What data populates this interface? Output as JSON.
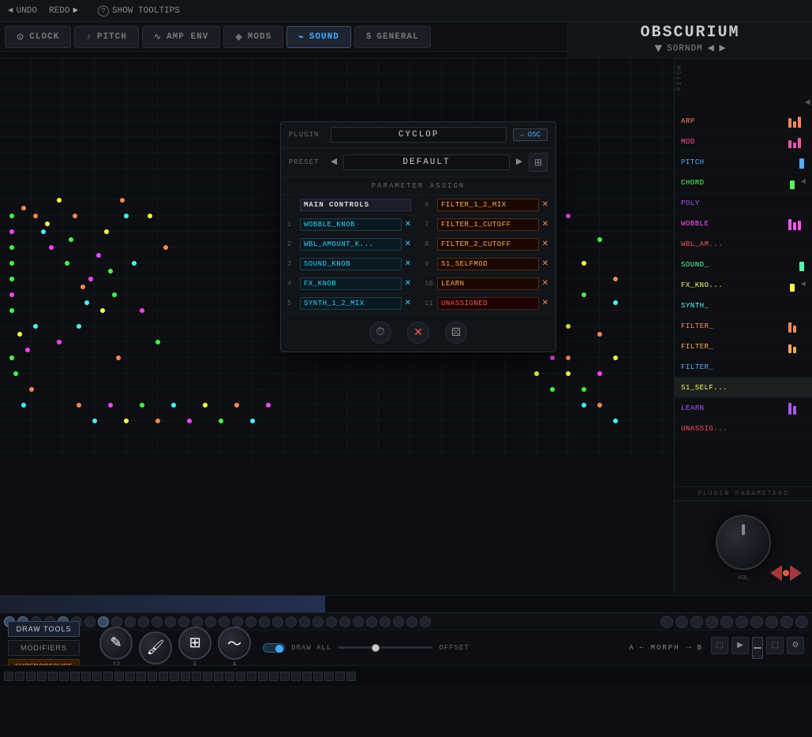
{
  "app": {
    "title": "OBSCURIUM",
    "preset_name": "SORNDM"
  },
  "topbar": {
    "undo": "UNDO",
    "redo": "REDO",
    "show_tooltips": "SHOW TOOLTIPS"
  },
  "nav_tabs": [
    {
      "id": "clock",
      "label": "CLOCK",
      "icon": "⊙",
      "active": false
    },
    {
      "id": "pitch",
      "label": "PITCH",
      "icon": "♪",
      "active": false
    },
    {
      "id": "amp_env",
      "label": "AMP ENV",
      "icon": "∿",
      "active": false
    },
    {
      "id": "mods",
      "label": "MODS",
      "icon": "◈",
      "active": false
    },
    {
      "id": "sound",
      "label": "SOUND",
      "icon": "⌁",
      "active": true
    },
    {
      "id": "general",
      "label": "GENERAL",
      "icon": "$",
      "active": false
    }
  ],
  "dialog": {
    "plugin_label": "PLUGIN",
    "plugin_value": "CYCLOP",
    "preset_label": "PRESET",
    "preset_value": "DEFAULT",
    "osc_label": "OSC",
    "section_title": "PARAMETER ASSIGN",
    "params_left": [
      {
        "num": "",
        "name": "MAIN CONTROLS",
        "style": "main",
        "x_color": "none"
      },
      {
        "num": "1",
        "name": "WOBBLE_KNOB",
        "style": "cyan",
        "x_color": "cyan"
      },
      {
        "num": "2",
        "name": "WBL_AMOUNT_K...",
        "style": "cyan",
        "x_color": "cyan"
      },
      {
        "num": "3",
        "name": "SOUND_KNOB",
        "style": "cyan",
        "x_color": "cyan"
      },
      {
        "num": "4",
        "name": "FX_KNOB",
        "style": "cyan",
        "x_color": "cyan"
      },
      {
        "num": "5",
        "name": "SYNTH_1_2_MIX",
        "style": "cyan",
        "x_color": "cyan"
      }
    ],
    "params_right": [
      {
        "num": "6",
        "name": "FILTER_1_2_MIX",
        "style": "orange",
        "x_color": "orange"
      },
      {
        "num": "7",
        "name": "FILTER_1_CUTOFF",
        "style": "orange",
        "x_color": "orange"
      },
      {
        "num": "8",
        "name": "FILTER_2_CUTOFF",
        "style": "orange",
        "x_color": "orange"
      },
      {
        "num": "9",
        "name": "S1_SELFMOD",
        "style": "orange",
        "x_color": "orange"
      },
      {
        "num": "10",
        "name": "LEARN",
        "style": "orange",
        "x_color": "orange"
      },
      {
        "num": "11",
        "name": "UNASSIGNED",
        "style": "orange",
        "x_color": "orange"
      }
    ]
  },
  "sidebar": {
    "params": [
      {
        "id": "arp",
        "label": "ARP",
        "color": "#f85"
      },
      {
        "id": "mod",
        "label": "MOD",
        "color": "#f5a"
      },
      {
        "id": "pitch",
        "label": "PITCH",
        "color": "#5af"
      },
      {
        "id": "chord",
        "label": "CHORD",
        "color": "#5f5"
      },
      {
        "id": "poly",
        "label": "POLY",
        "color": "#a5f"
      },
      {
        "id": "wobble",
        "label": "WOBBLE",
        "color": "#f5f"
      },
      {
        "id": "wbl_am",
        "label": "WBL_AM...",
        "color": "#f55"
      },
      {
        "id": "sound",
        "label": "SOUND_",
        "color": "#5fa"
      },
      {
        "id": "fx_kno",
        "label": "FX_KNO...",
        "color": "#ff5"
      },
      {
        "id": "synth",
        "label": "SYNTH_",
        "color": "#5ff"
      },
      {
        "id": "filter1",
        "label": "FILTER_",
        "color": "#f85"
      },
      {
        "id": "filter2",
        "label": "FILTER_",
        "color": "#fa5"
      },
      {
        "id": "filter3",
        "label": "FILTER_",
        "color": "#5af"
      },
      {
        "id": "s1self",
        "label": "S1_SELF...",
        "color": "#5f5"
      },
      {
        "id": "learn",
        "label": "LEARN",
        "color": "#a5f"
      },
      {
        "id": "unassigned",
        "label": "UNASSIG...",
        "color": "#f55"
      }
    ]
  },
  "bottom": {
    "draw_tools": "DRAW TOOLS",
    "modifiers": "MODIFIERS",
    "superobscure": "SUPEROBSCURE",
    "draw_all": "DRAW ALL",
    "offset": "OFFSET",
    "morph": "MORPH",
    "morph_a": "A",
    "morph_b": "B"
  }
}
